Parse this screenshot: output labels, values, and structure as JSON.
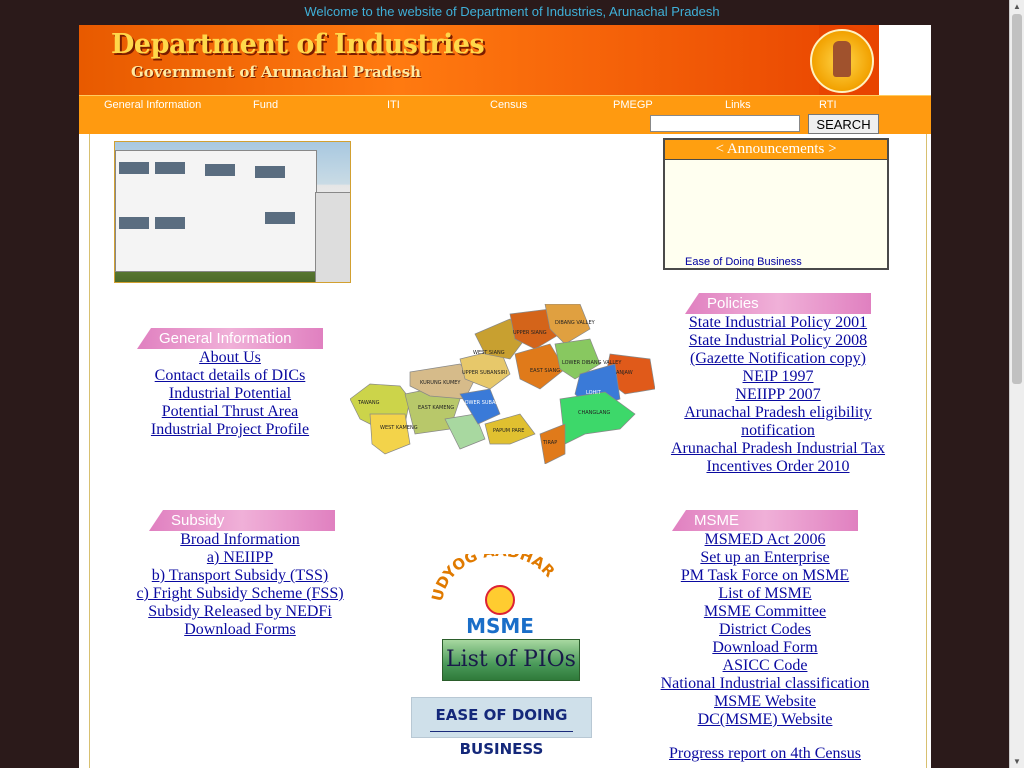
{
  "welcome": "Welcome to the website of Department of Industries, Arunachal Pradesh",
  "header": {
    "title": "Department of Industries",
    "subtitle": "Government of Arunachal Pradesh"
  },
  "nav": [
    "General Information",
    "Fund",
    "ITI",
    "Census",
    "PMEGP",
    "Links",
    "RTI"
  ],
  "search": {
    "button_label": "SEARCH",
    "value": ""
  },
  "announcements": {
    "title": "< Announcements >",
    "ticker": "Ease of Doing Business"
  },
  "general_information": {
    "title": "General Information",
    "links": [
      "About Us",
      "Contact details of DICs",
      "Industrial Potential",
      "Potential Thrust Area",
      "Industrial Project Profile"
    ]
  },
  "policies": {
    "title": "Policies",
    "links": [
      "State Industrial Policy 2001",
      "State Industrial Policy 2008",
      "(Gazette Notification copy)",
      "NEIP 1997",
      "NEIIPP 2007",
      "Arunachal Pradesh eligibility",
      "notification",
      "Arunachal Pradesh Industrial Tax",
      "Incentives Order 2010"
    ]
  },
  "subsidy": {
    "title": "Subsidy",
    "links": [
      "Broad Information ",
      "a) NEIIPP",
      "b) Transport Subsidy (TSS)",
      "c) Fright Subsidy Scheme (FSS) ",
      "Subsidy Released by NEDFi ",
      "Download Forms "
    ]
  },
  "msme": {
    "title": "MSME",
    "links": [
      "MSMED Act 2006",
      "Set up an Enterprise",
      "PM Task Force on MSME",
      "List of MSME",
      "MSME Committee",
      "District Codes",
      "Download Form",
      "ASICC Code",
      "National Industrial classification",
      "MSME Website",
      "DC(MSME) Website"
    ]
  },
  "progress_report": "Progress report on 4th Census",
  "udyog": {
    "top": "UDYOG AADHAR",
    "bottom": "MSME"
  },
  "pio_label": "List of PIOs",
  "eodb_label": "EASE OF DOING BUSINESS",
  "map_labels": [
    "WEST SIANG",
    "UPPER SIANG",
    "DIBANG VALLEY",
    "UPPER SUBANSIRI",
    "EAST SIANG",
    "LOWER DIBANG VALLEY",
    "ANJAW",
    "KURUNG KUMEY",
    "LOWER SUBANSIRI",
    "LOHIT",
    "TAWANG",
    "WEST KAMENG",
    "EAST KAMENG",
    "PAPUM PARE",
    "CHANGLANG",
    "TIRAP"
  ],
  "colors": {
    "header_orange": "#e85a00",
    "nav_orange": "#ff9a10",
    "link_blue": "#0a0aa0",
    "section_pink": "#e080c0"
  }
}
